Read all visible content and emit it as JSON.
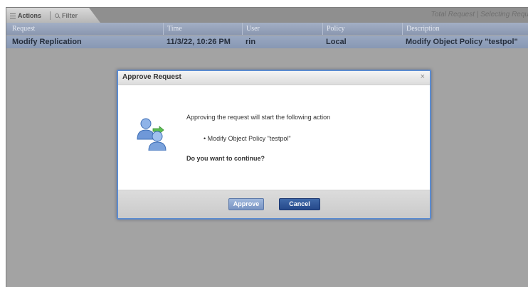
{
  "toolbar": {
    "actions_label": "Actions",
    "filter_label": "Filter",
    "total_text": "Total Request | Selecting Requ"
  },
  "table": {
    "columns": [
      "Request",
      "Time",
      "User",
      "Policy",
      "Description"
    ],
    "rows": [
      {
        "request": "Modify Replication",
        "time": "11/3/22, 10:26 PM",
        "user": "rin",
        "policy": "Local",
        "description": "Modify Object Policy \"testpol\""
      }
    ]
  },
  "dialog": {
    "title": "Approve Request",
    "close_symbol": "×",
    "message": "Approving the request will start the following action",
    "action_item": "• Modify Object Policy \"testpol\"",
    "question": "Do you want to continue?",
    "approve_label": "Approve",
    "cancel_label": "Cancel"
  },
  "icons": {
    "actions": "list-icon",
    "filter": "search-icon",
    "dialog": "users-icon",
    "close": "close-icon"
  },
  "colors": {
    "header_bg": "#8a97b0",
    "row_bg": "#9aa8c1",
    "overlay": "#a3a3a3",
    "dialog_border": "#5b8bd0",
    "cancel_btn": "#25498a"
  }
}
